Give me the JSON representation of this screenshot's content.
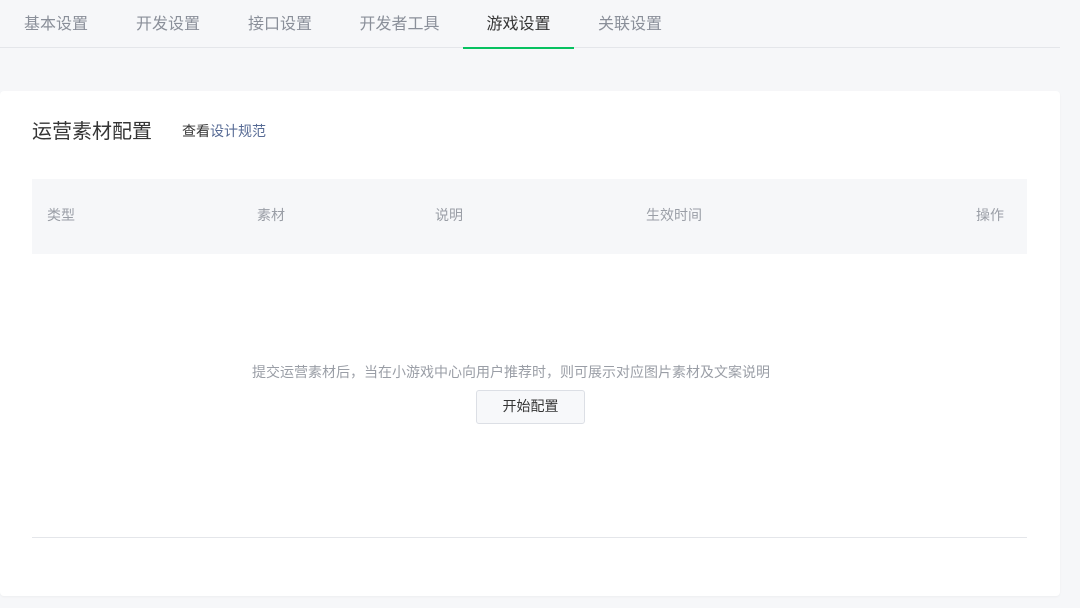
{
  "tabs": [
    {
      "label": "基本设置",
      "active": false
    },
    {
      "label": "开发设置",
      "active": false
    },
    {
      "label": "接口设置",
      "active": false
    },
    {
      "label": "开发者工具",
      "active": false
    },
    {
      "label": "游戏设置",
      "active": true
    },
    {
      "label": "关联设置",
      "active": false
    }
  ],
  "section": {
    "title": "运营素材配置",
    "spec_prefix": "查看",
    "spec_link": "设计规范"
  },
  "table": {
    "columns": [
      "类型",
      "素材",
      "说明",
      "生效时间",
      "操作"
    ],
    "rows": []
  },
  "empty_state": {
    "message": "提交运营素材后，当在小游戏中心向用户推荐时，则可展示对应图片素材及文案说明",
    "button_label": "开始配置"
  },
  "colors": {
    "accent": "#07c160",
    "link": "#576b95",
    "text_primary": "#353535",
    "text_secondary": "#9a9ea6",
    "page_bg": "#f6f7f9"
  }
}
